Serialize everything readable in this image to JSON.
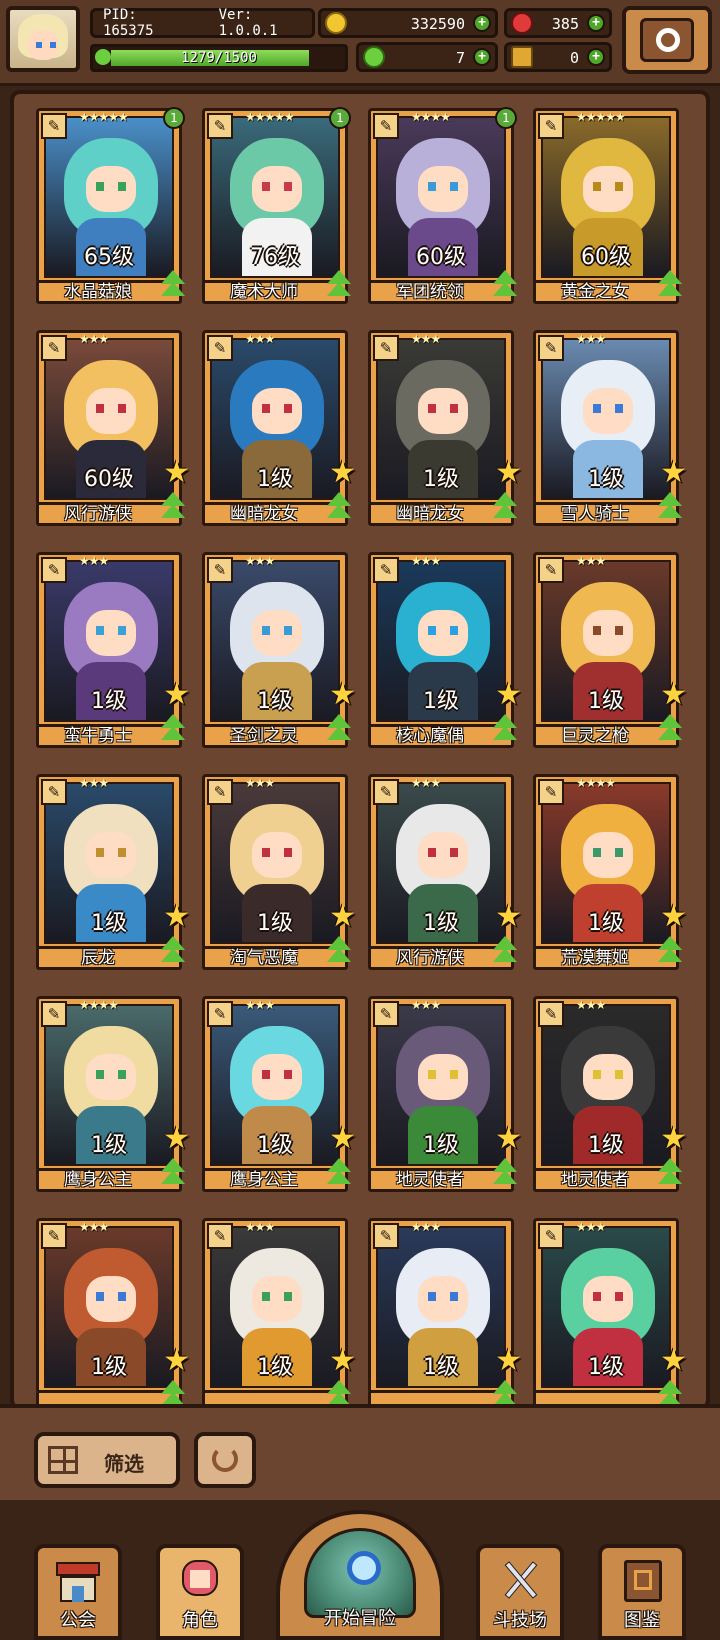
{
  "header": {
    "pid_label": "PID: 165375",
    "version_label": "Ver: 1.0.0.1",
    "xp_text": "1279/1500",
    "xp_fraction": 0.853,
    "gold": "332590",
    "gems": "385",
    "clover": "7",
    "keys": "0"
  },
  "cards": [
    {
      "name": "水晶菇娘",
      "level": "65级",
      "stars": "★★★★★",
      "badge": "1",
      "hair": "#5fd0c8",
      "body": "#3f7fbf",
      "eye": "#3aa05a",
      "bg": "#4a8fc8",
      "weapon": "✎",
      "upstar": false
    },
    {
      "name": "魔术大师",
      "level": "76级",
      "stars": "★★★★★",
      "badge": "1",
      "hair": "#6bc9a8",
      "body": "#f2f2f2",
      "eye": "#c83a4a",
      "bg": "#3a6a7a",
      "weapon": "✎",
      "upstar": false
    },
    {
      "name": "军团统领",
      "level": "60级",
      "stars": "★★★★",
      "badge": "1",
      "hair": "#b8b0d8",
      "body": "#6a4a8a",
      "eye": "#3a9ad5",
      "bg": "#4a3a5a",
      "weapon": "✎",
      "upstar": false
    },
    {
      "name": "黄金之女",
      "level": "60级",
      "stars": "★★★★★",
      "badge": "",
      "hair": "#e0b840",
      "body": "#c89a2a",
      "eye": "#b88a1a",
      "bg": "#8a6a2a",
      "weapon": "✎",
      "upstar": false
    },
    {
      "name": "风行游侠",
      "level": "60级",
      "stars": "★★★",
      "badge": "",
      "hair": "#f2c060",
      "body": "#2a2a3a",
      "eye": "#c03040",
      "bg": "#7a4a3a",
      "weapon": "✎",
      "upstar": true
    },
    {
      "name": "幽暗龙女",
      "level": "1级",
      "stars": "★★★",
      "badge": "",
      "hair": "#2a7ac0",
      "body": "#8a6a3a",
      "eye": "#c03040",
      "bg": "#2a4a6a",
      "weapon": "✎",
      "upstar": true
    },
    {
      "name": "幽暗龙女",
      "level": "1级",
      "stars": "★★★",
      "badge": "",
      "hair": "#6a6a60",
      "body": "#3a3a30",
      "eye": "#c03040",
      "bg": "#3a3a36",
      "weapon": "✎",
      "upstar": true
    },
    {
      "name": "雪人骑士",
      "level": "1级",
      "stars": "★★★",
      "badge": "",
      "hair": "#e8eef6",
      "body": "#8ab8e0",
      "eye": "#3a7bd5",
      "bg": "#6a8ab0",
      "weapon": "✎",
      "upstar": true
    },
    {
      "name": "蛮牛勇士",
      "level": "1级",
      "stars": "★★★",
      "badge": "",
      "hair": "#9a7ac0",
      "body": "#5a3a7a",
      "eye": "#3aa0d5",
      "bg": "#3a3a6a",
      "weapon": "✎",
      "upstar": true
    },
    {
      "name": "圣剑之灵",
      "level": "1级",
      "stars": "★★★",
      "badge": "",
      "hair": "#dde4ee",
      "body": "#c8a050",
      "eye": "#3a9ad5",
      "bg": "#3a4a6a",
      "weapon": "✎",
      "upstar": true
    },
    {
      "name": "核心魔偶",
      "level": "1级",
      "stars": "★★★",
      "badge": "",
      "hair": "#2ab0d0",
      "body": "#2a3a4a",
      "eye": "#2aa0e0",
      "bg": "#1a3a5a",
      "weapon": "✎",
      "upstar": true
    },
    {
      "name": "巨灵之枪",
      "level": "1级",
      "stars": "★★★",
      "badge": "",
      "hair": "#f0b850",
      "body": "#a03030",
      "eye": "#8a4a2a",
      "bg": "#6a3a2a",
      "weapon": "✎",
      "upstar": true
    },
    {
      "name": "辰龙",
      "level": "1级",
      "stars": "★★★",
      "badge": "",
      "hair": "#f0e0c0",
      "body": "#3a8ac8",
      "eye": "#c09030",
      "bg": "#2a4a6a",
      "weapon": "✎",
      "upstar": true
    },
    {
      "name": "淘气恶魔",
      "level": "1级",
      "stars": "★★★",
      "badge": "",
      "hair": "#f0d090",
      "body": "#3a2a2a",
      "eye": "#c03040",
      "bg": "#4a3a3a",
      "weapon": "✎",
      "upstar": true
    },
    {
      "name": "风行游侠",
      "level": "1级",
      "stars": "★★★",
      "badge": "",
      "hair": "#e8e8e8",
      "body": "#3a6a4a",
      "eye": "#c03040",
      "bg": "#3a4a4a",
      "weapon": "✎",
      "upstar": true
    },
    {
      "name": "荒漠舞姬",
      "level": "1级",
      "stars": "★★★★",
      "badge": "",
      "hair": "#f0b040",
      "body": "#c04030",
      "eye": "#3a9a6a",
      "bg": "#8a3a2a",
      "weapon": "✎",
      "upstar": true
    },
    {
      "name": "鹰身公主",
      "level": "1级",
      "stars": "★★★★",
      "badge": "",
      "hair": "#f0dca0",
      "body": "#3a7a8a",
      "eye": "#3aa05a",
      "bg": "#4a6a6a",
      "weapon": "✎",
      "upstar": true
    },
    {
      "name": "鹰身公主",
      "level": "1级",
      "stars": "★★★",
      "badge": "",
      "hair": "#6ad8e0",
      "body": "#c08a4a",
      "eye": "#c03040",
      "bg": "#3a5a7a",
      "weapon": "✎",
      "upstar": true
    },
    {
      "name": "地灵使者",
      "level": "1级",
      "stars": "★★★",
      "badge": "",
      "hair": "#6a5a7a",
      "body": "#3a8a3a",
      "eye": "#e0c030",
      "bg": "#3a3a4a",
      "weapon": "✎",
      "upstar": true
    },
    {
      "name": "地灵使者",
      "level": "1级",
      "stars": "★★★",
      "badge": "",
      "hair": "#3a3a3a",
      "body": "#a02a2a",
      "eye": "#e0c030",
      "bg": "#2a2a2a",
      "weapon": "✎",
      "upstar": true
    },
    {
      "name": "",
      "level": "1级",
      "stars": "★★★",
      "badge": "",
      "hair": "#c05a30",
      "body": "#8a4a2a",
      "eye": "#3a7ad5",
      "bg": "#6a3a2a",
      "weapon": "✎",
      "upstar": true
    },
    {
      "name": "",
      "level": "1级",
      "stars": "★★★",
      "badge": "",
      "hair": "#ede8e0",
      "body": "#e09a30",
      "eye": "#3aa05a",
      "bg": "#3a3a3a",
      "weapon": "✎",
      "upstar": true
    },
    {
      "name": "",
      "level": "1级",
      "stars": "★★★",
      "badge": "",
      "hair": "#e8ecf4",
      "body": "#d0a040",
      "eye": "#3a7ad5",
      "bg": "#2a3a5a",
      "weapon": "✎",
      "upstar": true
    },
    {
      "name": "",
      "level": "1级",
      "stars": "★★★",
      "badge": "",
      "hair": "#5ad0a0",
      "body": "#c03040",
      "eye": "#c03040",
      "bg": "#2a4a4a",
      "weapon": "✎",
      "upstar": true
    }
  ],
  "filter": {
    "label": "筛选"
  },
  "nav": {
    "guild": "公会",
    "character": "角色",
    "adventure": "开始冒险",
    "arena": "斗技场",
    "codex": "图鉴"
  }
}
